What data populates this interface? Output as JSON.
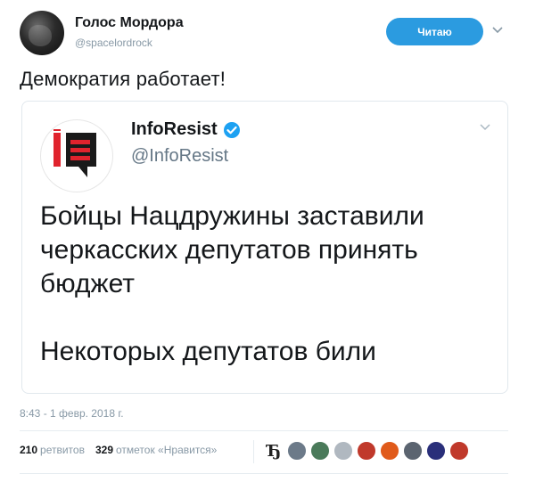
{
  "tweet": {
    "author_name": "Голос Мордора",
    "author_handle": "@spacelordrock",
    "follow_label": "Читаю",
    "text": "Демократия работает!",
    "timestamp": "8:43 - 1 февр. 2018 г.",
    "retweets_count": "210",
    "retweets_label": "ретвитов",
    "likes_count": "329",
    "likes_label": "отметок «Нравится»"
  },
  "quoted": {
    "name": "InfoResist",
    "handle": "@InfoResist",
    "lines": [
      "Бойцы Нацдружины заставили",
      "черкасских депутатов принять",
      "бюджет",
      "Некоторых депутатов били"
    ]
  },
  "likers": {
    "first_glyph": "Ђ",
    "colors": [
      "#6c7a89",
      "#4a7a5a",
      "#b0b8c0",
      "#c0392b",
      "#e05a1a",
      "#5b6470",
      "#2a2f7a",
      "#c0392b"
    ]
  },
  "colors": {
    "accent": "#2b9be0",
    "verified": "#1da1f2",
    "logo_red": "#e0232d"
  }
}
